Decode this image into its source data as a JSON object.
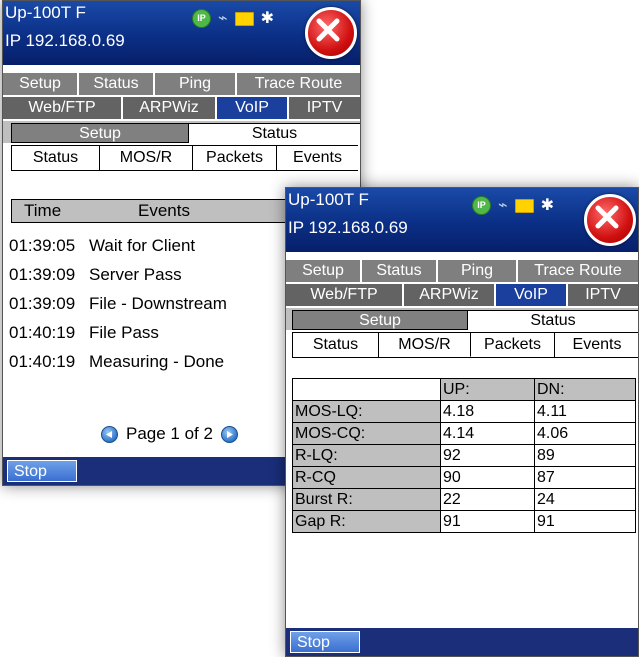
{
  "device": {
    "name": "Up-100T F",
    "ip": "IP 192.168.0.69",
    "status_icons": [
      "ip-icon",
      "plug-icon",
      "folder-icon",
      "bluetooth-icon"
    ],
    "ip_icon_text": "IP",
    "close_icon": "close-icon"
  },
  "menu": {
    "row1": [
      "Setup",
      "Status",
      "Ping",
      "Trace Route"
    ],
    "row2": [
      "Web/FTP",
      "ARPWiz",
      "VoIP",
      "IPTV"
    ],
    "active": "VoIP"
  },
  "voip_tabs": {
    "setup": "Setup",
    "status": "Status",
    "active": "Status"
  },
  "status_tabs": [
    "Status",
    "MOS/R",
    "Packets",
    "Events"
  ],
  "screen1": {
    "active_status_tab": "Events",
    "events_header": {
      "time": "Time",
      "events": "Events"
    },
    "events": [
      {
        "time": "01:39:05",
        "event": "Wait for Client"
      },
      {
        "time": "01:39:09",
        "event": "Server Pass"
      },
      {
        "time": "01:39:09",
        "event": "File - Downstream"
      },
      {
        "time": "01:40:19",
        "event": "File Pass"
      },
      {
        "time": "01:40:19",
        "event": "Measuring - Done"
      }
    ],
    "pager": "Page 1 of 2",
    "stop": "Stop"
  },
  "screen2": {
    "active_status_tab": "MOS/R",
    "mos_header": {
      "blank": "",
      "up": "UP:",
      "dn": "DN:"
    },
    "mos_rows": [
      {
        "label": "MOS-LQ:",
        "up": "4.18",
        "dn": "4.11"
      },
      {
        "label": "MOS-CQ:",
        "up": "4.14",
        "dn": "4.06"
      },
      {
        "label": "R-LQ:",
        "up": "92",
        "dn": "89"
      },
      {
        "label": "R-CQ",
        "up": "90",
        "dn": "87"
      },
      {
        "label": "Burst R:",
        "up": "22",
        "dn": "24"
      },
      {
        "label": "Gap R:",
        "up": "91",
        "dn": "91"
      }
    ],
    "stop": "Stop"
  },
  "colors": {
    "title_bar": "#0b2f86",
    "active_tab": "#1b3f9c",
    "tab_gray": "#7f7f7f",
    "close": "#d01010",
    "bottom_bar": "#1a2e7a"
  }
}
